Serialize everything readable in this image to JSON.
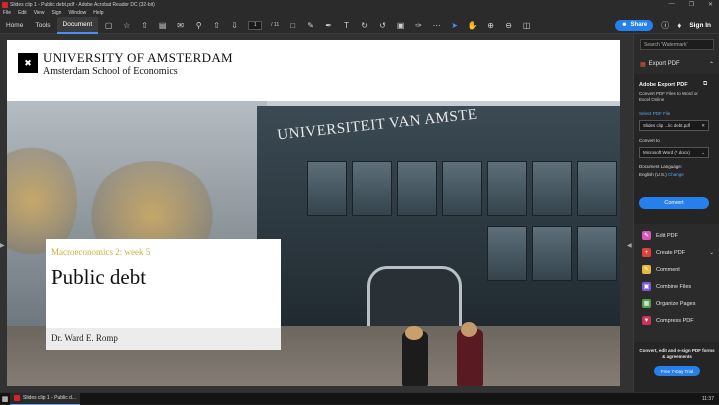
{
  "window": {
    "title": "Slides clip 1 - Public debt.pdf - Adobe Acrobat Reader DC (32-bit)",
    "controls": [
      "—",
      "❐",
      "✕"
    ]
  },
  "menu": [
    "File",
    "Edit",
    "View",
    "Sign",
    "Window",
    "Help"
  ],
  "toolbar": {
    "tabs": [
      "Home",
      "Tools",
      "Document"
    ],
    "page_current": "1",
    "page_total": "/ 11",
    "share_label": "Share",
    "sign_in_label": "Sign In"
  },
  "document": {
    "university": "UNIVERSITY OF AMSTERDAM",
    "school": "Amsterdam School of Economics",
    "building_sign": "UNIVERSITEIT VAN AMSTE",
    "course": "Macroeconomics 2: week 5",
    "title": "Public debt",
    "author": "Dr. Ward E. Romp"
  },
  "right_pane": {
    "search_placeholder": "Search 'Watermark'",
    "export_header": "Export PDF",
    "panel_title": "Adobe Export PDF",
    "panel_desc": "Convert PDF Files to Word or Excel Online",
    "select_label": "Select PDF File",
    "file_name": "Slides clip ...lic debt.pdf",
    "convert_to_label": "Convert to",
    "convert_to_value": "Microsoft Word (*.docx)",
    "doc_lang_label": "Document Language:",
    "doc_lang_value": "English (U.S.)",
    "change_label": "Change",
    "convert_button": "Convert",
    "tools": [
      {
        "label": "Edit PDF",
        "color": "#d957b9"
      },
      {
        "label": "Create PDF",
        "color": "#e0413a"
      },
      {
        "label": "Comment",
        "color": "#e6b73c"
      },
      {
        "label": "Combine Files",
        "color": "#7a5cd6"
      },
      {
        "label": "Organize Pages",
        "color": "#53a14b"
      },
      {
        "label": "Compress PDF",
        "color": "#d12f5a"
      }
    ],
    "promo_text": "Convert, edit and e-sign PDF forms & agreements",
    "trial_button": "Free 7-Day Trial"
  },
  "taskbar": {
    "app_label": "Slides clip 1 - Public d...",
    "time": "11:37"
  }
}
